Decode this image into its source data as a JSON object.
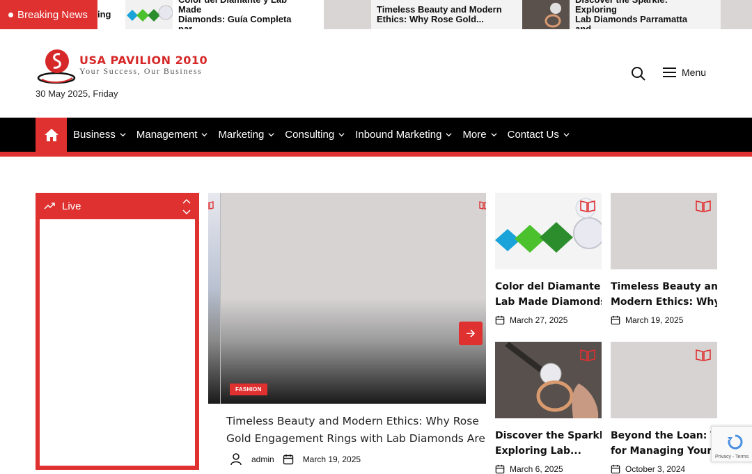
{
  "breaking": {
    "label": "Breaking News",
    "items": [
      {
        "title_l1": "...",
        "title_l2": "..."
      },
      {
        "title_l1": "Color del Diamante y Lab Made",
        "title_l2": "Diamonds: Guía Completa par..."
      },
      {
        "title_l1": "Timeless Beauty and Modern",
        "title_l2": "Ethics: Why Rose Gold..."
      },
      {
        "title_l1": "Discover the Sparkle: Exploring",
        "title_l2": "Lab Diamonds Parramatta and..."
      }
    ],
    "partial_left": {
      "l1": "ing",
      "l2": ""
    }
  },
  "site": {
    "brand": "USA PAVILION 2010",
    "tagline": "Your Success, Our Business",
    "date": "30 May 2025, Friday",
    "colors": {
      "accent": "#e03131",
      "nav_bg": "#000000"
    }
  },
  "header": {
    "search_icon": "search-icon",
    "menu_label": "Menu"
  },
  "nav": {
    "home_icon": "home-icon",
    "items": [
      "Business",
      "Management",
      "Marketing",
      "Consulting",
      "Inbound Marketing",
      "More",
      "Contact Us"
    ]
  },
  "live": {
    "title": "Live"
  },
  "feature": {
    "category": "FASHION",
    "title_l1": "Timeless Beauty and Modern Ethics: Why Rose",
    "title_l2": "Gold Engagement Rings with Lab Diamonds Are...",
    "author": "admin",
    "date": "March 19, 2025"
  },
  "cards": [
    {
      "title_l1": "Color del Diamante y",
      "title_l2": "Lab Made Diamonds...",
      "date": "March 27, 2025"
    },
    {
      "title_l1": "Timeless Beauty and",
      "title_l2": "Modern Ethics: Why...",
      "date": "March 19, 2025"
    },
    {
      "title_l1": "Discover the Sparkle:",
      "title_l2": "Exploring Lab...",
      "date": "March 6, 2025"
    },
    {
      "title_l1": "Beyond the Loan: Tips",
      "title_l2": "for Managing Your...",
      "date": "October 3, 2024"
    }
  ],
  "recaptcha": {
    "text": "Privacy - Terms"
  }
}
